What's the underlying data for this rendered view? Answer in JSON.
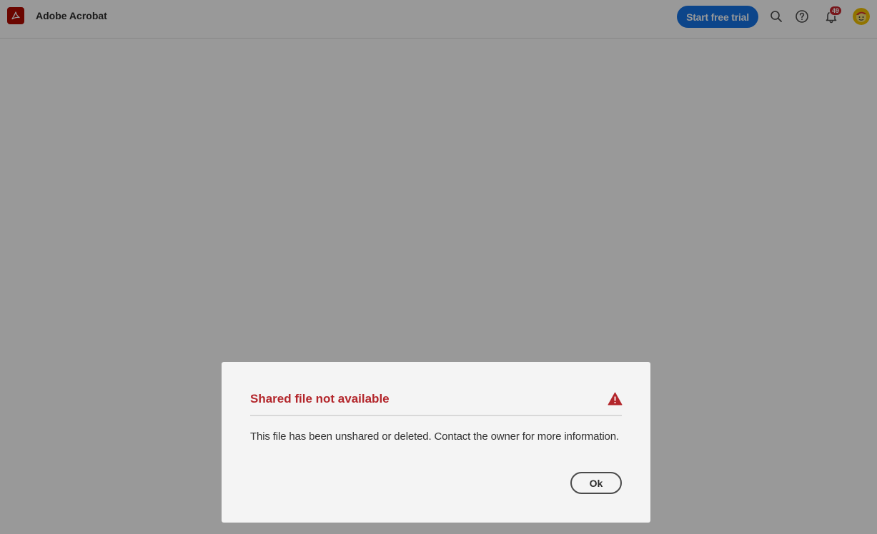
{
  "header": {
    "app_title": "Adobe Acrobat",
    "logo_icon": "acrobat-logo-icon",
    "trial_button_label": "Start free trial",
    "notification_count": "49",
    "icons": [
      "search-icon",
      "help-icon",
      "bell-icon",
      "avatar"
    ]
  },
  "dialog": {
    "title": "Shared file not available",
    "alert_icon": "alert-triangle-icon",
    "message": "This file has been unshared or deleted. Contact the owner for more information.",
    "ok_label": "Ok"
  },
  "colors": {
    "brand_red": "#b30b00",
    "title_red": "#b3262b",
    "accent_blue": "#1473e6",
    "badge_red": "#c9252d",
    "overlay": "rgba(0,0,0,0.40)",
    "dialog_bg": "#f4f4f4"
  }
}
